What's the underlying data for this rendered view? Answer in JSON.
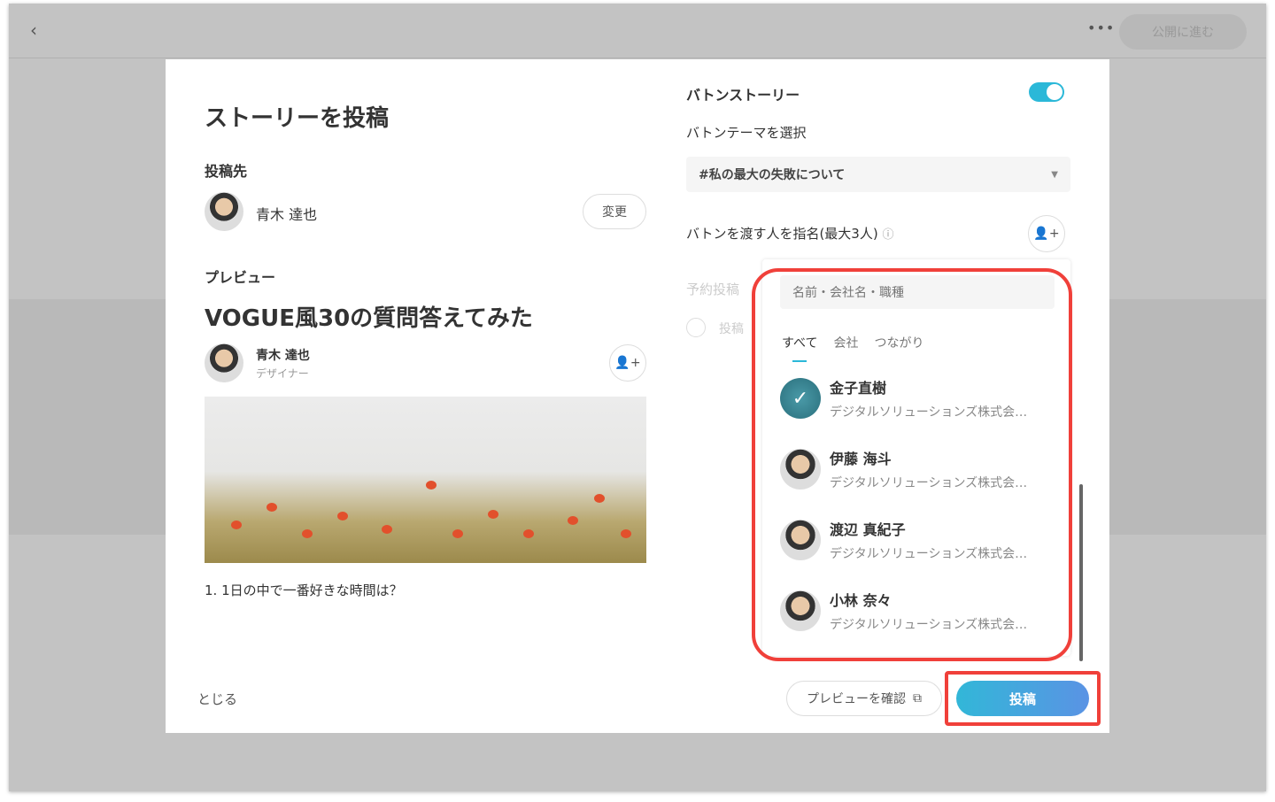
{
  "topbar": {
    "back_icon": "chevron-left",
    "more_icon": "ellipsis",
    "publish_label": "公開に進む"
  },
  "left": {
    "title": "ストーリーを投稿",
    "destination_label": "投稿先",
    "destination_user": "青木 達也",
    "change_label": "変更",
    "preview_label": "プレビュー",
    "story_title": "VOGUE風30の質問答えてみた",
    "author_name": "青木 達也",
    "author_role": "デザイナー",
    "question": "1. 1日の中で一番好きな時間は？",
    "close_label": "とじる"
  },
  "right": {
    "baton_label": "バトンストーリー",
    "baton_enabled": true,
    "theme_label": "バトンテーマを選択",
    "theme_value": "#私の最大の失敗について",
    "nominate_label": "バトンを渡す人を指名(最大3人)",
    "schedule_label": "予約投稿",
    "schedule_option": "投稿",
    "search_placeholder": "名前・会社名・職種",
    "tabs": [
      "すべて",
      "会社",
      "つながり"
    ],
    "people": [
      {
        "name": "金子直樹",
        "company": "デジタルソリューションズ株式会…",
        "selected": true
      },
      {
        "name": "伊藤 海斗",
        "company": "デジタルソリューションズ株式会…",
        "selected": false
      },
      {
        "name": "渡辺 真紀子",
        "company": "デジタルソリューションズ株式会…",
        "selected": false
      },
      {
        "name": "小林 奈々",
        "company": "デジタルソリューションズ株式会…",
        "selected": false
      }
    ],
    "preview_button": "プレビューを確認",
    "post_button": "投稿"
  },
  "colors": {
    "accent": "#2bb8d8",
    "highlight": "#f0403a"
  }
}
